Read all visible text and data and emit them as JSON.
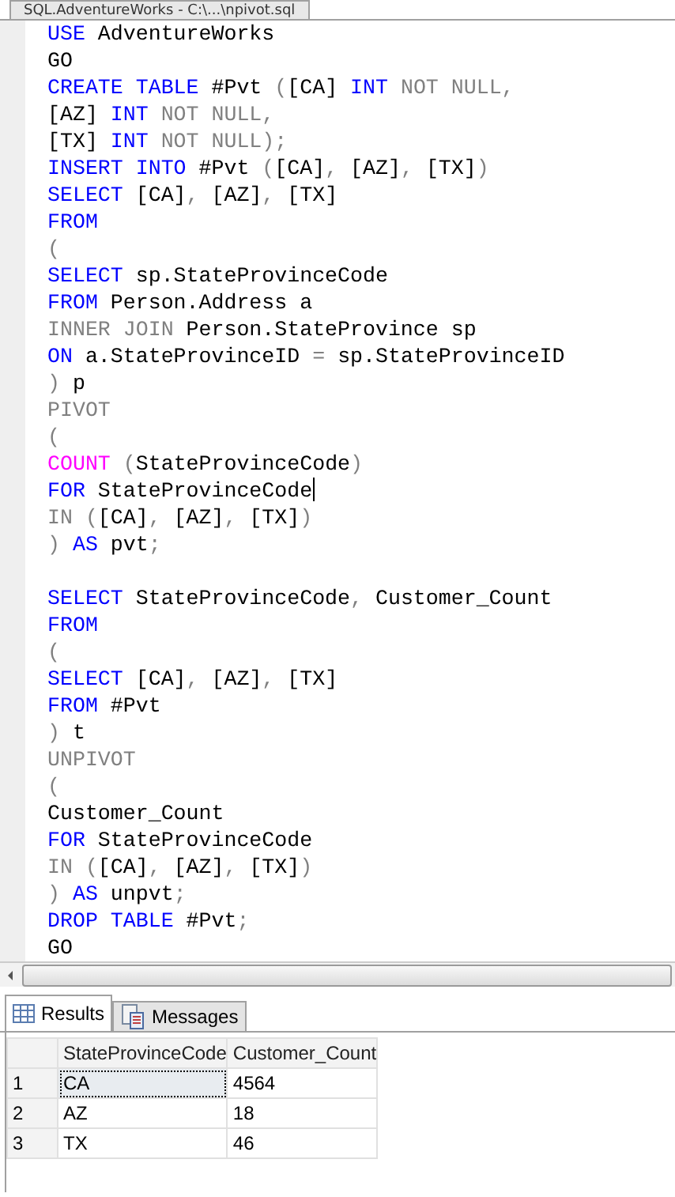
{
  "document_tab": {
    "title": "SQL.AdventureWorks - C:\\...\\npivot.sql"
  },
  "editor": {
    "lines": [
      {
        "kind": "code",
        "caret": false,
        "segments": [
          {
            "kind": "kw",
            "text": "USE"
          },
          {
            "kind": "id",
            "text": " AdventureWorks"
          }
        ]
      },
      {
        "kind": "code",
        "caret": false,
        "segments": [
          {
            "kind": "id",
            "text": "GO"
          }
        ]
      },
      {
        "kind": "code",
        "caret": false,
        "segments": [
          {
            "kind": "kw",
            "text": "CREATE TABLE"
          },
          {
            "kind": "id",
            "text": " #Pvt "
          },
          {
            "kind": "op",
            "text": "("
          },
          {
            "kind": "id",
            "text": "[CA] "
          },
          {
            "kind": "kw",
            "text": "INT "
          },
          {
            "kind": "op",
            "text": "NOT NULL,"
          }
        ]
      },
      {
        "kind": "code",
        "caret": false,
        "segments": [
          {
            "kind": "id",
            "text": "[AZ] "
          },
          {
            "kind": "kw",
            "text": "INT "
          },
          {
            "kind": "op",
            "text": "NOT NULL,"
          }
        ]
      },
      {
        "kind": "code",
        "caret": false,
        "segments": [
          {
            "kind": "id",
            "text": "[TX] "
          },
          {
            "kind": "kw",
            "text": "INT "
          },
          {
            "kind": "op",
            "text": "NOT NULL);"
          }
        ]
      },
      {
        "kind": "code",
        "caret": false,
        "segments": [
          {
            "kind": "kw",
            "text": "INSERT INTO"
          },
          {
            "kind": "id",
            "text": " #Pvt "
          },
          {
            "kind": "op",
            "text": "("
          },
          {
            "kind": "id",
            "text": "[CA]"
          },
          {
            "kind": "op",
            "text": ", "
          },
          {
            "kind": "id",
            "text": "[AZ]"
          },
          {
            "kind": "op",
            "text": ", "
          },
          {
            "kind": "id",
            "text": "[TX]"
          },
          {
            "kind": "op",
            "text": ")"
          }
        ]
      },
      {
        "kind": "code",
        "caret": false,
        "segments": [
          {
            "kind": "kw",
            "text": "SELECT "
          },
          {
            "kind": "id",
            "text": "[CA]"
          },
          {
            "kind": "op",
            "text": ", "
          },
          {
            "kind": "id",
            "text": "[AZ]"
          },
          {
            "kind": "op",
            "text": ", "
          },
          {
            "kind": "id",
            "text": "[TX]"
          }
        ]
      },
      {
        "kind": "code",
        "caret": false,
        "segments": [
          {
            "kind": "kw",
            "text": "FROM"
          }
        ]
      },
      {
        "kind": "code",
        "caret": false,
        "segments": [
          {
            "kind": "op",
            "text": "("
          }
        ]
      },
      {
        "kind": "code",
        "caret": false,
        "segments": [
          {
            "kind": "kw",
            "text": "SELECT "
          },
          {
            "kind": "id",
            "text": "sp.StateProvinceCode"
          }
        ]
      },
      {
        "kind": "code",
        "caret": false,
        "segments": [
          {
            "kind": "kw",
            "text": "FROM "
          },
          {
            "kind": "id",
            "text": "Person.Address a"
          }
        ]
      },
      {
        "kind": "code",
        "caret": false,
        "segments": [
          {
            "kind": "op",
            "text": "INNER JOIN "
          },
          {
            "kind": "id",
            "text": "Person.StateProvince sp"
          }
        ]
      },
      {
        "kind": "code",
        "caret": false,
        "segments": [
          {
            "kind": "kw",
            "text": "ON "
          },
          {
            "kind": "id",
            "text": "a.StateProvinceID "
          },
          {
            "kind": "op",
            "text": "= "
          },
          {
            "kind": "id",
            "text": "sp.StateProvinceID"
          }
        ]
      },
      {
        "kind": "code",
        "caret": false,
        "segments": [
          {
            "kind": "op",
            "text": ") "
          },
          {
            "kind": "id",
            "text": "p"
          }
        ]
      },
      {
        "kind": "code",
        "caret": false,
        "segments": [
          {
            "kind": "op",
            "text": "PIVOT"
          }
        ]
      },
      {
        "kind": "code",
        "caret": false,
        "segments": [
          {
            "kind": "op",
            "text": "("
          }
        ]
      },
      {
        "kind": "code",
        "caret": false,
        "segments": [
          {
            "kind": "fn",
            "text": "COUNT "
          },
          {
            "kind": "op",
            "text": "("
          },
          {
            "kind": "id",
            "text": "StateProvinceCode"
          },
          {
            "kind": "op",
            "text": ")"
          }
        ]
      },
      {
        "kind": "code",
        "caret": true,
        "segments": [
          {
            "kind": "kw",
            "text": "FOR "
          },
          {
            "kind": "id",
            "text": "StateProvinceCode"
          }
        ]
      },
      {
        "kind": "code",
        "caret": false,
        "segments": [
          {
            "kind": "op",
            "text": "IN ("
          },
          {
            "kind": "id",
            "text": "[CA]"
          },
          {
            "kind": "op",
            "text": ", "
          },
          {
            "kind": "id",
            "text": "[AZ]"
          },
          {
            "kind": "op",
            "text": ", "
          },
          {
            "kind": "id",
            "text": "[TX]"
          },
          {
            "kind": "op",
            "text": ")"
          }
        ]
      },
      {
        "kind": "code",
        "caret": false,
        "segments": [
          {
            "kind": "op",
            "text": ") "
          },
          {
            "kind": "kw",
            "text": "AS "
          },
          {
            "kind": "id",
            "text": "pvt"
          },
          {
            "kind": "op",
            "text": ";"
          }
        ]
      },
      {
        "kind": "blank"
      },
      {
        "kind": "code",
        "caret": false,
        "segments": [
          {
            "kind": "kw",
            "text": "SELECT "
          },
          {
            "kind": "id",
            "text": "StateProvinceCode"
          },
          {
            "kind": "op",
            "text": ", "
          },
          {
            "kind": "id",
            "text": "Customer_Count"
          }
        ]
      },
      {
        "kind": "code",
        "caret": false,
        "segments": [
          {
            "kind": "kw",
            "text": "FROM"
          }
        ]
      },
      {
        "kind": "code",
        "caret": false,
        "segments": [
          {
            "kind": "op",
            "text": "("
          }
        ]
      },
      {
        "kind": "code",
        "caret": false,
        "segments": [
          {
            "kind": "kw",
            "text": "SELECT "
          },
          {
            "kind": "id",
            "text": "[CA]"
          },
          {
            "kind": "op",
            "text": ", "
          },
          {
            "kind": "id",
            "text": "[AZ]"
          },
          {
            "kind": "op",
            "text": ", "
          },
          {
            "kind": "id",
            "text": "[TX]"
          }
        ]
      },
      {
        "kind": "code",
        "caret": false,
        "segments": [
          {
            "kind": "kw",
            "text": "FROM "
          },
          {
            "kind": "id",
            "text": "#Pvt"
          }
        ]
      },
      {
        "kind": "code",
        "caret": false,
        "segments": [
          {
            "kind": "op",
            "text": ") "
          },
          {
            "kind": "id",
            "text": "t"
          }
        ]
      },
      {
        "kind": "code",
        "caret": false,
        "segments": [
          {
            "kind": "op",
            "text": "UNPIVOT"
          }
        ]
      },
      {
        "kind": "code",
        "caret": false,
        "segments": [
          {
            "kind": "op",
            "text": "("
          }
        ]
      },
      {
        "kind": "code",
        "caret": false,
        "segments": [
          {
            "kind": "id",
            "text": "Customer_Count"
          }
        ]
      },
      {
        "kind": "code",
        "caret": false,
        "segments": [
          {
            "kind": "kw",
            "text": "FOR "
          },
          {
            "kind": "id",
            "text": "StateProvinceCode"
          }
        ]
      },
      {
        "kind": "code",
        "caret": false,
        "segments": [
          {
            "kind": "op",
            "text": "IN ("
          },
          {
            "kind": "id",
            "text": "[CA]"
          },
          {
            "kind": "op",
            "text": ", "
          },
          {
            "kind": "id",
            "text": "[AZ]"
          },
          {
            "kind": "op",
            "text": ", "
          },
          {
            "kind": "id",
            "text": "[TX]"
          },
          {
            "kind": "op",
            "text": ")"
          }
        ]
      },
      {
        "kind": "code",
        "caret": false,
        "segments": [
          {
            "kind": "op",
            "text": ") "
          },
          {
            "kind": "kw",
            "text": "AS "
          },
          {
            "kind": "id",
            "text": "unpvt"
          },
          {
            "kind": "op",
            "text": ";"
          }
        ]
      },
      {
        "kind": "code",
        "caret": false,
        "segments": [
          {
            "kind": "kw",
            "text": "DROP TABLE "
          },
          {
            "kind": "id",
            "text": "#Pvt"
          },
          {
            "kind": "op",
            "text": ";"
          }
        ]
      },
      {
        "kind": "code",
        "caret": false,
        "segments": [
          {
            "kind": "id",
            "text": "GO"
          }
        ]
      }
    ]
  },
  "results_tabs": [
    {
      "label": "Results",
      "kind": "grid",
      "selected": true
    },
    {
      "label": "Messages",
      "kind": "messages",
      "selected": false
    }
  ],
  "results_grid": {
    "columns": [
      "StateProvinceCode",
      "Customer_Count"
    ],
    "rows": [
      {
        "number": "1",
        "cells": [
          {
            "text": "CA",
            "focused": true
          },
          {
            "text": "4564",
            "focused": false
          }
        ]
      },
      {
        "number": "2",
        "cells": [
          {
            "text": "AZ",
            "focused": false
          },
          {
            "text": "18",
            "focused": false
          }
        ]
      },
      {
        "number": "3",
        "cells": [
          {
            "text": "TX",
            "focused": false
          },
          {
            "text": "46",
            "focused": false
          }
        ]
      }
    ]
  }
}
